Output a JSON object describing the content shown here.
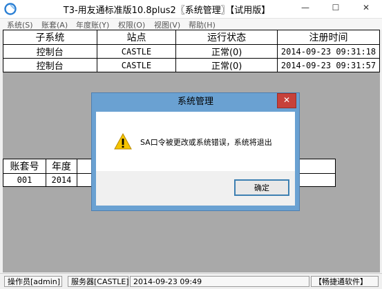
{
  "window": {
    "title": "T3-用友通标准版10.8plus2〖系统管理〗【试用版】",
    "minimize": "—",
    "maximize": "☐",
    "close": "✕"
  },
  "menu": [
    {
      "label": "系统(S)"
    },
    {
      "label": "账套(A)"
    },
    {
      "label": "年度账(Y)"
    },
    {
      "label": "权限(O)"
    },
    {
      "label": "视图(V)"
    },
    {
      "label": "帮助(H)"
    }
  ],
  "subsystem_table": {
    "headers": [
      "子系统",
      "站点",
      "运行状态",
      "注册时间"
    ],
    "rows": [
      [
        "控制台",
        "CASTLE",
        "正常(0)",
        "2014-09-23 09:31:18"
      ],
      [
        "控制台",
        "CASTLE",
        "正常(0)",
        "2014-09-23 09:31:57"
      ]
    ]
  },
  "account_table": {
    "headers": [
      "账套号",
      "年度"
    ],
    "rows": [
      [
        "001",
        "2014"
      ]
    ]
  },
  "dialog": {
    "title": "系统管理",
    "close": "✕",
    "message": "SA口令被更改或系统错误，系统将退出",
    "ok_label": "确定"
  },
  "status": {
    "operator": "操作员[admin]",
    "server": "服务器[CASTLE]",
    "datetime": "2014-09-23 09:49",
    "brand": "【畅捷通软件】"
  },
  "colors": {
    "dialog_frame": "#6aa1d2",
    "close_button": "#c7413a",
    "warning_icon": "#f5c400"
  }
}
